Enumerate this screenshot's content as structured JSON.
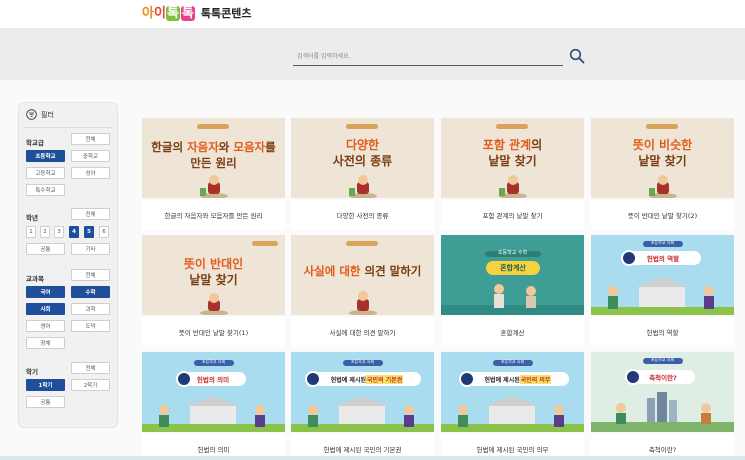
{
  "header": {
    "logo_letters": [
      "아",
      "이",
      "톡",
      "톡"
    ],
    "title": "톡톡콘텐츠"
  },
  "search": {
    "placeholder": "검색어를 입력하세요.",
    "icon": "search-icon"
  },
  "sidebar": {
    "title": "필터",
    "groups": {
      "school": {
        "label": "학교급",
        "all": "전체",
        "options": [
          "초등학교",
          "중학교",
          "고등학교",
          "성아",
          "특수학교"
        ],
        "selected": "초등학교"
      },
      "grade": {
        "label": "학년",
        "all": "전체",
        "options": [
          "1",
          "2",
          "3",
          "4",
          "5",
          "6"
        ],
        "extra": [
          "공통",
          "기타"
        ],
        "selected": [
          "4",
          "5"
        ]
      },
      "subject": {
        "label": "교과목",
        "all": "전체",
        "options": [
          "국어",
          "수학",
          "사회",
          "과학",
          "영어",
          "도덕",
          "창체"
        ],
        "selected": [
          "국어",
          "수학",
          "사회"
        ]
      },
      "term": {
        "label": "학기",
        "all": "전체",
        "options": [
          "1학기",
          "2학기",
          "공통"
        ],
        "selected": "1학기"
      }
    }
  },
  "cards": [
    {
      "thumb_title_1": "한글의 ",
      "thumb_hl_1": "자음자",
      "thumb_title_2": "와 ",
      "thumb_hl_2": "모음자",
      "thumb_title_3": "를",
      "thumb_line2": "만든 원리",
      "caption": "한글의 자음자와 모음자를 만든 원리"
    },
    {
      "thumb_title": "다양한",
      "thumb_line2": "사전의 종류",
      "caption": "다양한 사전의 종류"
    },
    {
      "thumb_hl": "포함 관계",
      "thumb_title": "의",
      "thumb_line2": "낱말 찾기",
      "caption": "포함 관계의 낱말 찾기"
    },
    {
      "thumb_hl": "뜻이 비슷한",
      "thumb_line2": "낱말 찾기",
      "caption": "뜻이 반대인 낱말 찾기(2)"
    },
    {
      "thumb_hl": "뜻이 반대인",
      "thumb_line2": "낱말 찾기",
      "caption": "뜻이 반대인 낱말 찾기(1)"
    },
    {
      "thumb_hl": "사실에 대한",
      "thumb_title": " 의견 말하기",
      "caption": "사실에 대한 의견 말하기"
    },
    {
      "thumb_top": "초등학교 수학",
      "thumb_banner": "혼합계산",
      "caption": "혼합계산"
    },
    {
      "thumb_top": "초등학교 사회",
      "thumb_banner": "헌법의 역할",
      "caption": "헌법의 역할"
    },
    {
      "thumb_top": "초등학교 사회",
      "thumb_banner": "헌법의 의미",
      "caption": "헌법의 의미"
    },
    {
      "thumb_top": "초등학교 사회",
      "thumb_banner_a": "헌법에 제시된 ",
      "thumb_banner_b": "국민의 기본권",
      "caption": "헌법에 제시된 국민의 기본권"
    },
    {
      "thumb_top": "초등학교 사회",
      "thumb_banner_a": "헌법에 제시된 ",
      "thumb_banner_b": "국민의 의무",
      "caption": "헌법에 제시된 국민의 의무"
    },
    {
      "thumb_top": "초등학교 사회",
      "thumb_banner": "축척이란?",
      "caption": "축척이란?"
    }
  ],
  "colors": {
    "accent": "#1f4f9a",
    "beige": "#efe5d6",
    "teal": "#3e9e96",
    "sky": "#a9dcef",
    "orange": "#e25b1b"
  }
}
